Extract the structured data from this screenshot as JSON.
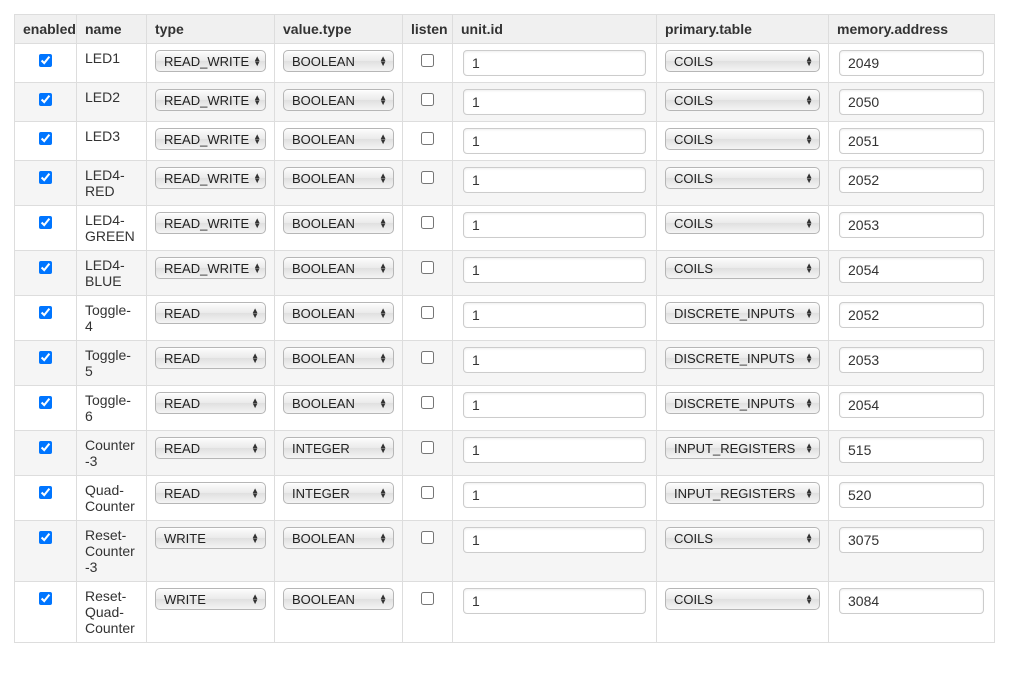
{
  "columns": {
    "enabled": "enabled",
    "name": "name",
    "type": "type",
    "value_type": "value.type",
    "listen": "listen",
    "unit_id": "unit.id",
    "primary_table": "primary.table",
    "memory_address": "memory.address"
  },
  "rows": [
    {
      "enabled": true,
      "name": "LED1",
      "type": "READ_WRITE",
      "value_type": "BOOLEAN",
      "listen": false,
      "unit_id": "1",
      "primary_table": "COILS",
      "memory_address": "2049"
    },
    {
      "enabled": true,
      "name": "LED2",
      "type": "READ_WRITE",
      "value_type": "BOOLEAN",
      "listen": false,
      "unit_id": "1",
      "primary_table": "COILS",
      "memory_address": "2050"
    },
    {
      "enabled": true,
      "name": "LED3",
      "type": "READ_WRITE",
      "value_type": "BOOLEAN",
      "listen": false,
      "unit_id": "1",
      "primary_table": "COILS",
      "memory_address": "2051"
    },
    {
      "enabled": true,
      "name": "LED4-RED",
      "type": "READ_WRITE",
      "value_type": "BOOLEAN",
      "listen": false,
      "unit_id": "1",
      "primary_table": "COILS",
      "memory_address": "2052"
    },
    {
      "enabled": true,
      "name": "LED4-GREEN",
      "type": "READ_WRITE",
      "value_type": "BOOLEAN",
      "listen": false,
      "unit_id": "1",
      "primary_table": "COILS",
      "memory_address": "2053"
    },
    {
      "enabled": true,
      "name": "LED4-BLUE",
      "type": "READ_WRITE",
      "value_type": "BOOLEAN",
      "listen": false,
      "unit_id": "1",
      "primary_table": "COILS",
      "memory_address": "2054"
    },
    {
      "enabled": true,
      "name": "Toggle-4",
      "type": "READ",
      "value_type": "BOOLEAN",
      "listen": false,
      "unit_id": "1",
      "primary_table": "DISCRETE_INPUTS",
      "memory_address": "2052"
    },
    {
      "enabled": true,
      "name": "Toggle-5",
      "type": "READ",
      "value_type": "BOOLEAN",
      "listen": false,
      "unit_id": "1",
      "primary_table": "DISCRETE_INPUTS",
      "memory_address": "2053"
    },
    {
      "enabled": true,
      "name": "Toggle-6",
      "type": "READ",
      "value_type": "BOOLEAN",
      "listen": false,
      "unit_id": "1",
      "primary_table": "DISCRETE_INPUTS",
      "memory_address": "2054"
    },
    {
      "enabled": true,
      "name": "Counter-3",
      "type": "READ",
      "value_type": "INTEGER",
      "listen": false,
      "unit_id": "1",
      "primary_table": "INPUT_REGISTERS",
      "memory_address": "515"
    },
    {
      "enabled": true,
      "name": "Quad-Counter",
      "type": "READ",
      "value_type": "INTEGER",
      "listen": false,
      "unit_id": "1",
      "primary_table": "INPUT_REGISTERS",
      "memory_address": "520"
    },
    {
      "enabled": true,
      "name": "Reset-Counter-3",
      "type": "WRITE",
      "value_type": "BOOLEAN",
      "listen": false,
      "unit_id": "1",
      "primary_table": "COILS",
      "memory_address": "3075"
    },
    {
      "enabled": true,
      "name": "Reset-Quad-Counter",
      "type": "WRITE",
      "value_type": "BOOLEAN",
      "listen": false,
      "unit_id": "1",
      "primary_table": "COILS",
      "memory_address": "3084"
    }
  ]
}
